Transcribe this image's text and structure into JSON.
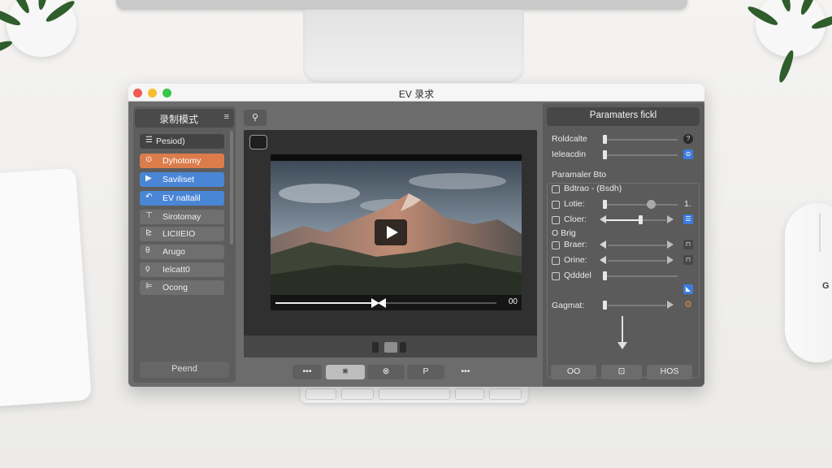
{
  "window": {
    "title": "EV 录求"
  },
  "sidebar": {
    "title": "录制模式",
    "items": [
      {
        "label": "Pesiod)",
        "icon": "☰"
      },
      {
        "label": "Dyhotomy",
        "icon": "⊙"
      },
      {
        "label": "Saviliset",
        "icon": "▶"
      },
      {
        "label": "EV naltalil",
        "icon": "↶"
      },
      {
        "label": "Sirotomay",
        "icon": "⊤"
      },
      {
        "label": "LICIIEIO",
        "icon": "⊵"
      },
      {
        "label": "Arugo",
        "icon": "θ"
      },
      {
        "label": "Ielcatt0",
        "icon": "ϙ"
      },
      {
        "label": "Ocong",
        "icon": "⊫"
      }
    ],
    "footer": "Peend"
  },
  "preview": {
    "video_time": "00",
    "progress": 0.45
  },
  "toolbar": {
    "buttons": [
      "•••",
      "⋇",
      "⊗",
      "P",
      "•••"
    ]
  },
  "panel": {
    "title": "Paramaters ﬁckl",
    "rows_top": [
      {
        "label": "Roldcalte",
        "badge": "?"
      },
      {
        "label": "Ieleacdin",
        "badge": "⊜"
      }
    ],
    "section_title": "Paramaler Bto",
    "rows_section": [
      {
        "label": "Bdtrao - (Bsdh)"
      },
      {
        "label": "Lotie:",
        "value": "1."
      },
      {
        "label": "Cloer:"
      }
    ],
    "subsection_title": "O Brig",
    "rows_sub": [
      {
        "label": "Braer:"
      },
      {
        "label": "Orine:"
      },
      {
        "label": "Qdddel"
      }
    ],
    "last_row": "Gagmat:",
    "buttons": [
      "OO",
      "⊡",
      "HOS"
    ],
    "colors": {
      "accent_blue": "#3d7ce0",
      "accent_orange": "#e08a3a"
    }
  }
}
